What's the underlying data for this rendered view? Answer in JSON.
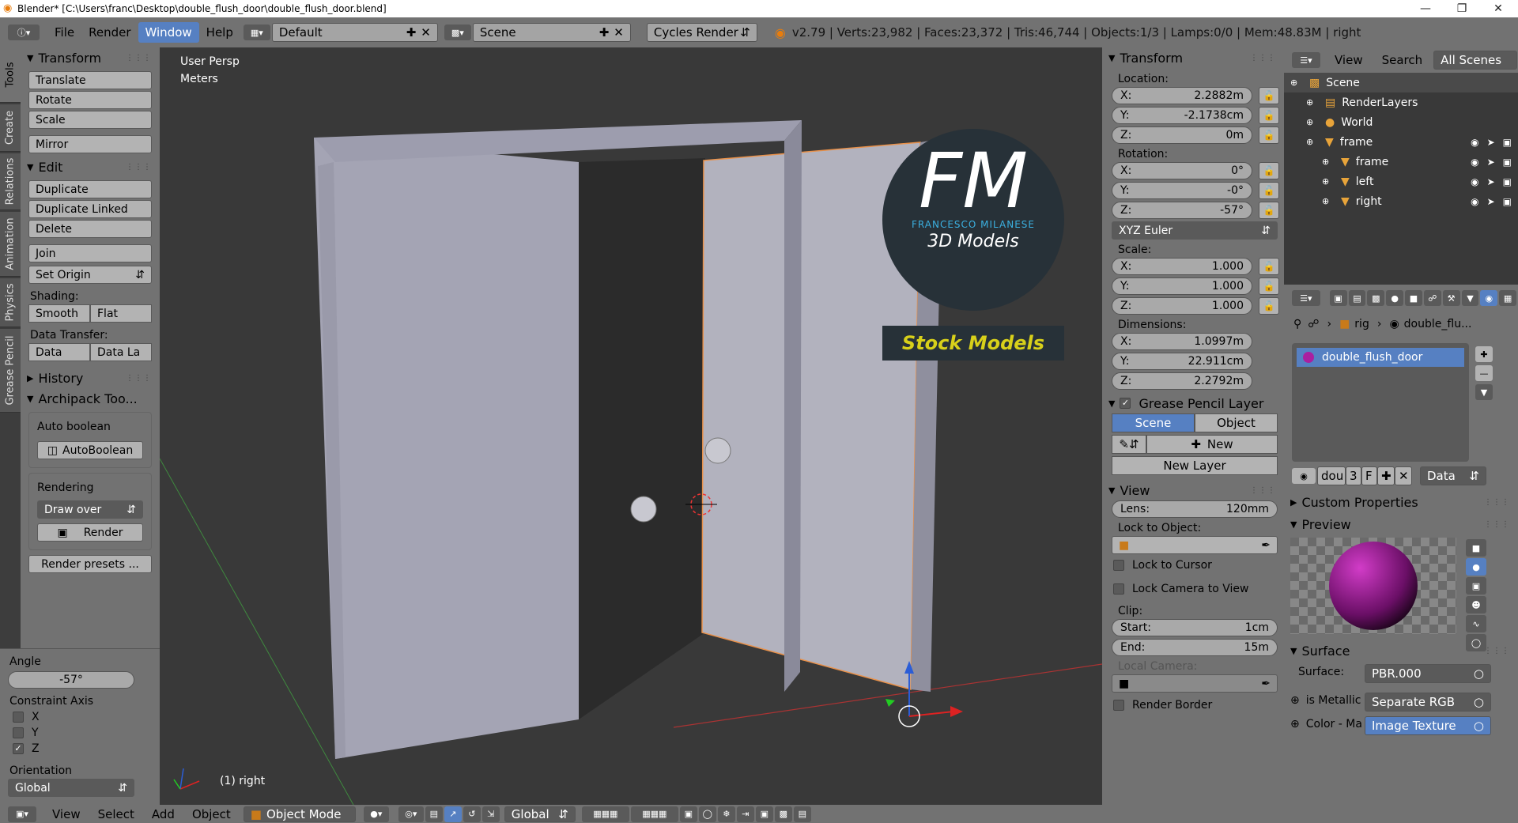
{
  "window": {
    "title": "Blender* [C:\\Users\\franc\\Desktop\\double_flush_door\\double_flush_door.blend]"
  },
  "menu": [
    "File",
    "Render",
    "Window",
    "Help"
  ],
  "active_menu": "Window",
  "screen_layout": "Default",
  "scene": "Scene",
  "render_engine": "Cycles Render",
  "info": "v2.79 | Verts:23,982 | Faces:23,372 | Tris:46,744 | Objects:1/3 | Lamps:0/0 | Mem:48.83M | right",
  "tabs": [
    "Tools",
    "Create",
    "Relations",
    "Animation",
    "Physics",
    "Grease Pencil"
  ],
  "toolshelf": {
    "transform_head": "Transform",
    "transform": [
      "Translate",
      "Rotate",
      "Scale"
    ],
    "mirror": "Mirror",
    "edit_head": "Edit",
    "edit": [
      "Duplicate",
      "Duplicate Linked",
      "Delete"
    ],
    "join": "Join",
    "set_origin": "Set Origin",
    "shading_label": "Shading:",
    "smooth": "Smooth",
    "flat": "Flat",
    "data_transfer_label": "Data Transfer:",
    "data": "Data",
    "data_la": "Data La",
    "history": "History",
    "archipack": "Archipack Too...",
    "auto_boolean": "Auto boolean",
    "autoboolean_btn": "AutoBoolean",
    "rendering": "Rendering",
    "draw_over": "Draw over",
    "render": "Render",
    "render_presets": "Render presets ..."
  },
  "last_op": {
    "angle_label": "Angle",
    "angle": "-57°",
    "constraint_label": "Constraint Axis",
    "axes": [
      "X",
      "Y",
      "Z"
    ],
    "orientation_label": "Orientation",
    "orientation": "Global"
  },
  "viewport": {
    "view": "User Persp",
    "units": "Meters",
    "object": "(1) right",
    "logo_fm": "FM",
    "logo_name": "FRANCESCO MILANESE",
    "logo_sub": "3D Models",
    "logo_stock": "Stock Models"
  },
  "npanel": {
    "transform_head": "Transform",
    "location_label": "Location:",
    "location": [
      {
        "k": "X:",
        "v": "2.2882m"
      },
      {
        "k": "Y:",
        "v": "-2.1738cm"
      },
      {
        "k": "Z:",
        "v": "0m"
      }
    ],
    "rotation_label": "Rotation:",
    "rotation": [
      {
        "k": "X:",
        "v": "0°"
      },
      {
        "k": "Y:",
        "v": "-0°"
      },
      {
        "k": "Z:",
        "v": "-57°"
      }
    ],
    "rotation_mode": "XYZ Euler",
    "scale_label": "Scale:",
    "scale": [
      {
        "k": "X:",
        "v": "1.000"
      },
      {
        "k": "Y:",
        "v": "1.000"
      },
      {
        "k": "Z:",
        "v": "1.000"
      }
    ],
    "dimensions_label": "Dimensions:",
    "dimensions": [
      {
        "k": "X:",
        "v": "1.0997m"
      },
      {
        "k": "Y:",
        "v": "22.911cm"
      },
      {
        "k": "Z:",
        "v": "2.2792m"
      }
    ],
    "gp_head": "Grease Pencil Layer",
    "gp_scene": "Scene",
    "gp_object": "Object",
    "gp_new": "New",
    "gp_new_layer": "New Layer",
    "view_head": "View",
    "lens_label": "Lens:",
    "lens": "120mm",
    "lock_obj_label": "Lock to Object:",
    "lock_cursor": "Lock to Cursor",
    "lock_camera": "Lock Camera to View",
    "clip_label": "Clip:",
    "clip_start_label": "Start:",
    "clip_start": "1cm",
    "clip_end_label": "End:",
    "clip_end": "15m",
    "local_camera": "Local Camera:",
    "render_border": "Render Border"
  },
  "outliner": {
    "view": "View",
    "search": "Search",
    "filter": "All Scenes",
    "items": [
      {
        "label": "Scene",
        "indent": 0
      },
      {
        "label": "RenderLayers",
        "indent": 1
      },
      {
        "label": "World",
        "indent": 1
      },
      {
        "label": "frame",
        "indent": 1
      },
      {
        "label": "frame",
        "indent": 2
      },
      {
        "label": "left",
        "indent": 2
      },
      {
        "label": "right",
        "indent": 2
      }
    ]
  },
  "props": {
    "breadcrumb_rig": "rig",
    "breadcrumb_mat": "double_flu...",
    "material_slot": "double_flush_door",
    "mat_name": "dou",
    "mat_users": "3",
    "mat_fake": "F",
    "link": "Data",
    "custom_props": "Custom Properties",
    "preview": "Preview",
    "surface_head": "Surface",
    "surface_label": "Surface:",
    "surface": "PBR.000",
    "is_metallic_label": "is Metallic",
    "is_metallic": "Separate RGB",
    "color_label": "Color - Ma",
    "color": "Image Texture"
  },
  "bottombar": {
    "view": "View",
    "select": "Select",
    "add": "Add",
    "object": "Object",
    "mode": "Object Mode",
    "orientation": "Global"
  }
}
